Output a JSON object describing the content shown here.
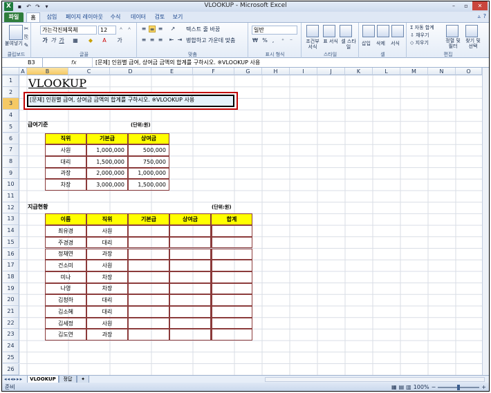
{
  "window": {
    "title": "VLOOKUP - Microsoft Excel",
    "app_icon": "X",
    "controls": [
      "–",
      "▫",
      "✕"
    ]
  },
  "ribbon_tabs": [
    "파일",
    "홈",
    "삽입",
    "페이지 레이아웃",
    "수식",
    "데이터",
    "검토",
    "보기"
  ],
  "ribbon": {
    "clipboard": {
      "paste": "붙여넣기",
      "label": "클립보드"
    },
    "font": {
      "name": "가는각진제목체",
      "size": "12",
      "bold": "가",
      "italic": "가",
      "underline": "가",
      "grow": "ᴬ",
      "shrink": "ᴬ",
      "label": "글꼴"
    },
    "alignment": {
      "wrap": "텍스트 줄 바꿈",
      "merge": "병합하고 가운데 맞춤",
      "label": "맞춤"
    },
    "number": {
      "format": "일반",
      "percent": "%",
      "comma": ",",
      "label": "표시 형식"
    },
    "styles": {
      "conditional": "조건부 서식",
      "table": "표 서식",
      "cell": "셀 스타일",
      "label": "스타일"
    },
    "cells": {
      "insert": "삽입",
      "delete": "삭제",
      "format": "서식",
      "label": "셀"
    },
    "editing": {
      "autosum": "자동 합계",
      "fill": "채우기",
      "clear": "지우기",
      "sort": "정렬 및 필터",
      "find": "찾기 및 선택",
      "label": "편집"
    }
  },
  "formula_bar": {
    "name_box": "B3",
    "fx": "fx",
    "content": "[문제] 인원별 급여, 상여금 금액의 합계를 구하시오. ※VLOOKUP 사용"
  },
  "columns": [
    "A",
    "B",
    "C",
    "D",
    "E",
    "F",
    "G",
    "H",
    "I",
    "J",
    "K",
    "L",
    "M",
    "N",
    "O"
  ],
  "rows": [
    "1",
    "2",
    "3",
    "4",
    "5",
    "6",
    "7",
    "8",
    "9",
    "10",
    "11",
    "12",
    "13",
    "14",
    "15",
    "16",
    "17",
    "18",
    "19",
    "20",
    "21",
    "22",
    "23",
    "24",
    "25",
    "26"
  ],
  "sheet": {
    "title": "VLOOKUP",
    "question": "[문제] 인원별 급여, 상여금 금액의 합계를 구하시오. ※VLOOKUP 사용",
    "table1": {
      "section": "급여기준",
      "unit": "(단위:원)",
      "headers": [
        "직위",
        "기본급",
        "상여금"
      ],
      "rows": [
        [
          "사원",
          "1,000,000",
          "500,000"
        ],
        [
          "대리",
          "1,500,000",
          "750,000"
        ],
        [
          "과장",
          "2,000,000",
          "1,000,000"
        ],
        [
          "차장",
          "3,000,000",
          "1,500,000"
        ]
      ]
    },
    "table2": {
      "section": "지급현황",
      "unit": "(단위:원)",
      "headers": [
        "이름",
        "직위",
        "기본급",
        "상여금",
        "합계"
      ],
      "rows": [
        [
          "최유경",
          "사원"
        ],
        [
          "주경경",
          "대리"
        ],
        [
          "정채연",
          "과장"
        ],
        [
          "건소미",
          "사원"
        ],
        [
          "미나",
          "차장"
        ],
        [
          "나영",
          "차장"
        ],
        [
          "김청하",
          "대리"
        ],
        [
          "김소혜",
          "대리"
        ],
        [
          "김세정",
          "사원"
        ],
        [
          "김도연",
          "과장"
        ]
      ]
    }
  },
  "sheet_tabs": [
    "VLOOKUP",
    "정답"
  ],
  "nav": "◂◂◂▸▸▸",
  "status": {
    "ready": "준비",
    "zoom": "100%",
    "minus": "−",
    "plus": "+"
  },
  "colors": {
    "header_fill": "#ffff00",
    "table_border": "#8b3a3a",
    "highlight_box": "#c00000"
  }
}
